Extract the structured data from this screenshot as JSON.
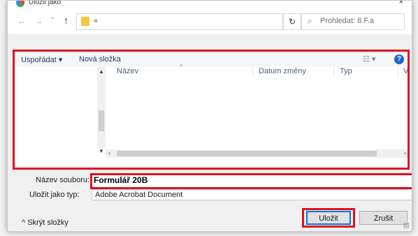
{
  "window": {
    "title": "Uložit jako",
    "close_glyph": "×"
  },
  "nav": {
    "back_glyph": "←",
    "forward_glyph": "→",
    "recent_glyph": "⌄",
    "up_glyph": "↑",
    "breadcrumb": "«",
    "refresh_glyph": "↻",
    "search_placeholder": "Prohledat: 8.F.a"
  },
  "toolbar": {
    "organize_label": "Uspořádat ▾",
    "new_folder_label": "Nová složka",
    "view_glyph": "☷ ▾",
    "help_glyph": "?"
  },
  "file_list": {
    "columns": [
      "Název",
      "Datum změny",
      "Typ",
      "V"
    ],
    "sort_caret": "^"
  },
  "scrollbars": {
    "up": "▲",
    "down": "▼",
    "left": "‹",
    "right": "›"
  },
  "form": {
    "filename_label": "Název souboru:",
    "filename_value": "Formulář 20B",
    "filetype_label": "Uložit jako typ:",
    "filetype_value": "Adobe Acrobat Document",
    "dropdown_glyph": "⌄"
  },
  "footer": {
    "hide_folders_label": "^  Skrýt složky",
    "save_label": "Uložit",
    "cancel_label": "Zrušit"
  },
  "colors": {
    "highlight": "#e0101f",
    "accent": "#0078d7",
    "folder": "#f5c542",
    "help": "#1e66d0"
  },
  "icons": [
    "chrome-app-icon",
    "back-arrow-icon",
    "forward-arrow-icon",
    "up-arrow-icon",
    "folder-icon",
    "refresh-icon",
    "search-icon",
    "view-options-icon",
    "help-icon"
  ]
}
